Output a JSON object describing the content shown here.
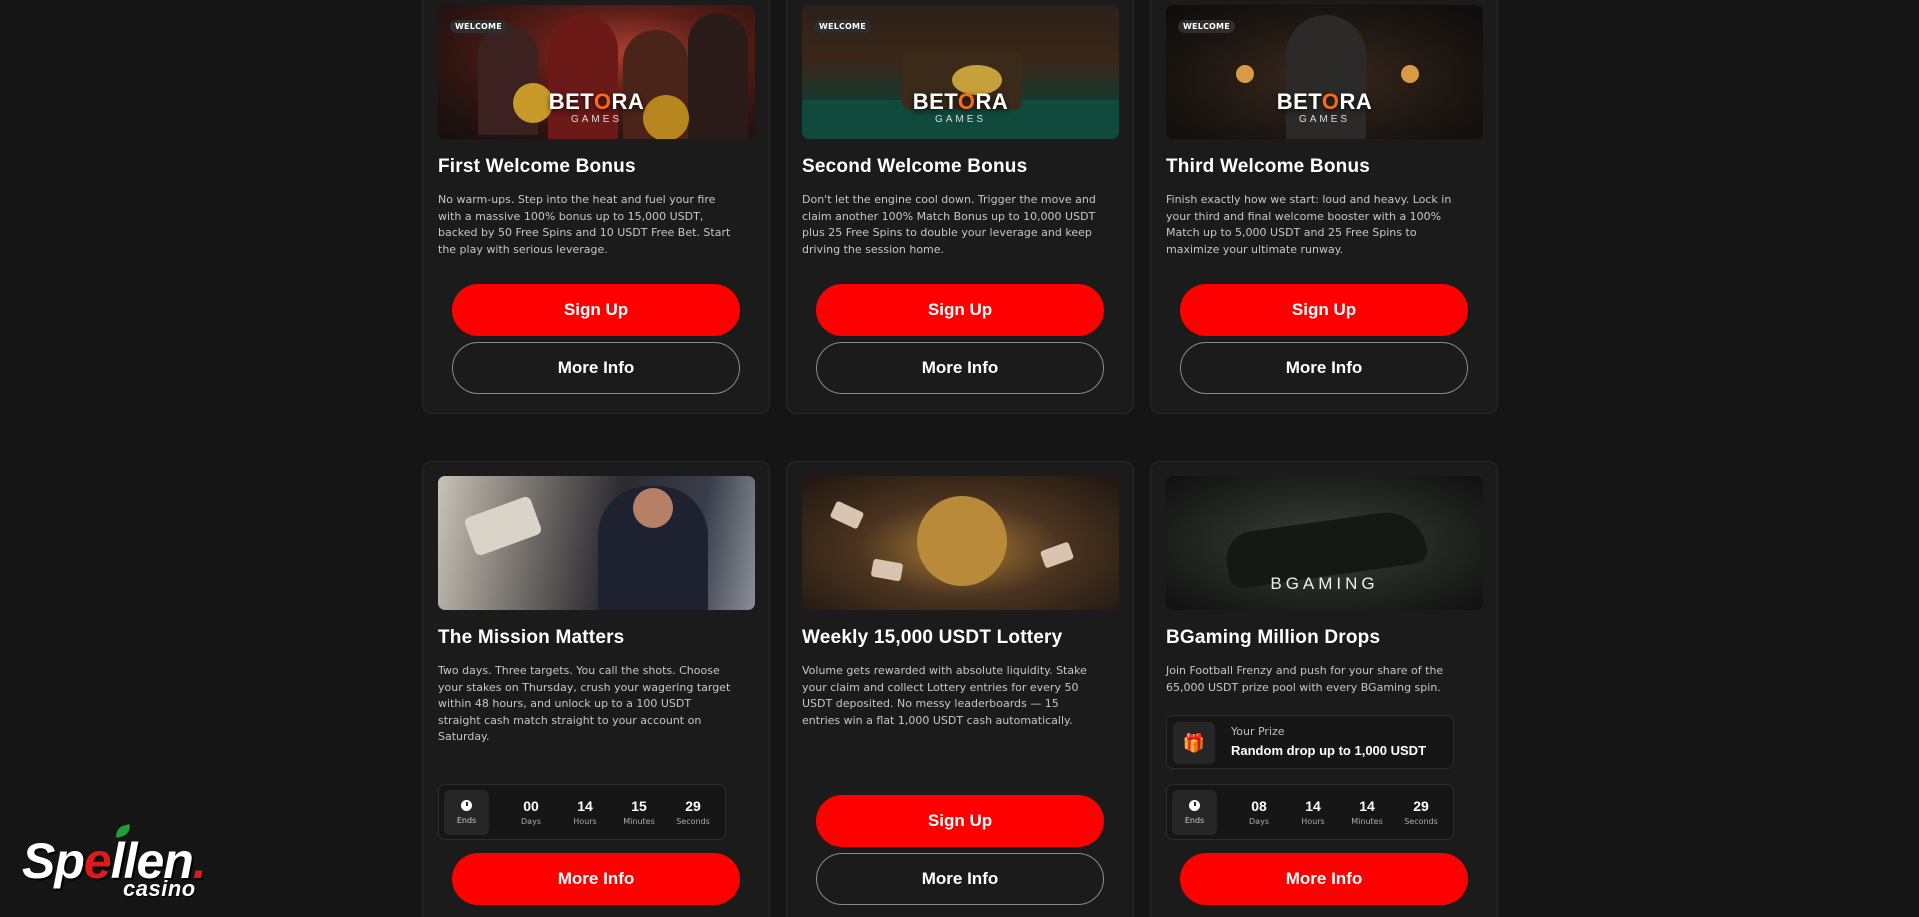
{
  "row1": [
    {
      "tag": "WELCOME",
      "banner_logo_a": "BET",
      "banner_logo_o": "O",
      "banner_logo_b": "RA",
      "banner_logo_sub": "GAMES",
      "title": "First Welcome Bonus",
      "description": "No warm-ups. Step into the heat and fuel your fire with a massive 100% bonus up to 15,000 USDT, backed by 50 Free Spins and 10 USDT Free Bet. Start the play with serious leverage.",
      "primary": "Sign Up",
      "secondary": "More Info"
    },
    {
      "tag": "WELCOME",
      "banner_logo_a": "BET",
      "banner_logo_o": "O",
      "banner_logo_b": "RA",
      "banner_logo_sub": "GAMES",
      "title": "Second Welcome Bonus",
      "description": "Don't let the engine cool down. Trigger the move and claim another 100% Match Bonus up to 10,000 USDT plus 25 Free Spins to double your leverage and keep driving the session home.",
      "primary": "Sign Up",
      "secondary": "More Info"
    },
    {
      "tag": "WELCOME",
      "banner_logo_a": "BET",
      "banner_logo_o": "O",
      "banner_logo_b": "RA",
      "banner_logo_sub": "GAMES",
      "title": "Third Welcome Bonus",
      "description": "Finish exactly how we start: loud and heavy. Lock in your third and final welcome booster with a 100% Match up to 5,000 USDT and 25 Free Spins to maximize your ultimate runway.",
      "primary": "Sign Up",
      "secondary": "More Info"
    }
  ],
  "row2": [
    {
      "title": "The Mission Matters",
      "description": "Two days. Three targets. You call the shots. Choose your stakes on Thursday, crush your wagering target within 48 hours, and unlock up to a 100 USDT straight cash match straight to your account on Saturday.",
      "timer": {
        "ends_label": "Ends",
        "days": "00",
        "days_label": "Days",
        "hours": "14",
        "hours_label": "Hours",
        "minutes": "15",
        "minutes_label": "Minutes",
        "seconds": "29",
        "seconds_label": "Seconds"
      },
      "primary": "More Info"
    },
    {
      "title": "Weekly 15,000 USDT Lottery",
      "description": "Volume gets rewarded with absolute liquidity. Stake your claim and collect Lottery entries for every 50 USDT deposited. No messy leaderboards — 15 entries win a flat 1,000 USDT cash automatically.",
      "primary": "Sign Up",
      "secondary": "More Info"
    },
    {
      "banner_brand_b": "B",
      "banner_brand_rest": "GAMING",
      "title": "BGaming Million Drops",
      "description": "Join Football Frenzy and push for your share of the 65,000 USDT prize pool with every BGaming spin.",
      "prize": {
        "label": "Your Prize",
        "value": "Random drop up to 1,000 USDT"
      },
      "timer": {
        "ends_label": "Ends",
        "days": "08",
        "days_label": "Days",
        "hours": "14",
        "hours_label": "Hours",
        "minutes": "14",
        "minutes_label": "Minutes",
        "seconds": "29",
        "seconds_label": "Seconds"
      },
      "primary": "More Info"
    }
  ],
  "brand": {
    "main_a": "Sp",
    "main_b": "llen",
    "main_dot": ".",
    "sub": "casino"
  },
  "colors": {
    "background": "#151515",
    "card": "#1b1b1b",
    "primary_button": "#ff0000",
    "outline": "#8a8a8a"
  },
  "icons": [
    "clock-icon",
    "gift-icon",
    "cherry-icon"
  ]
}
